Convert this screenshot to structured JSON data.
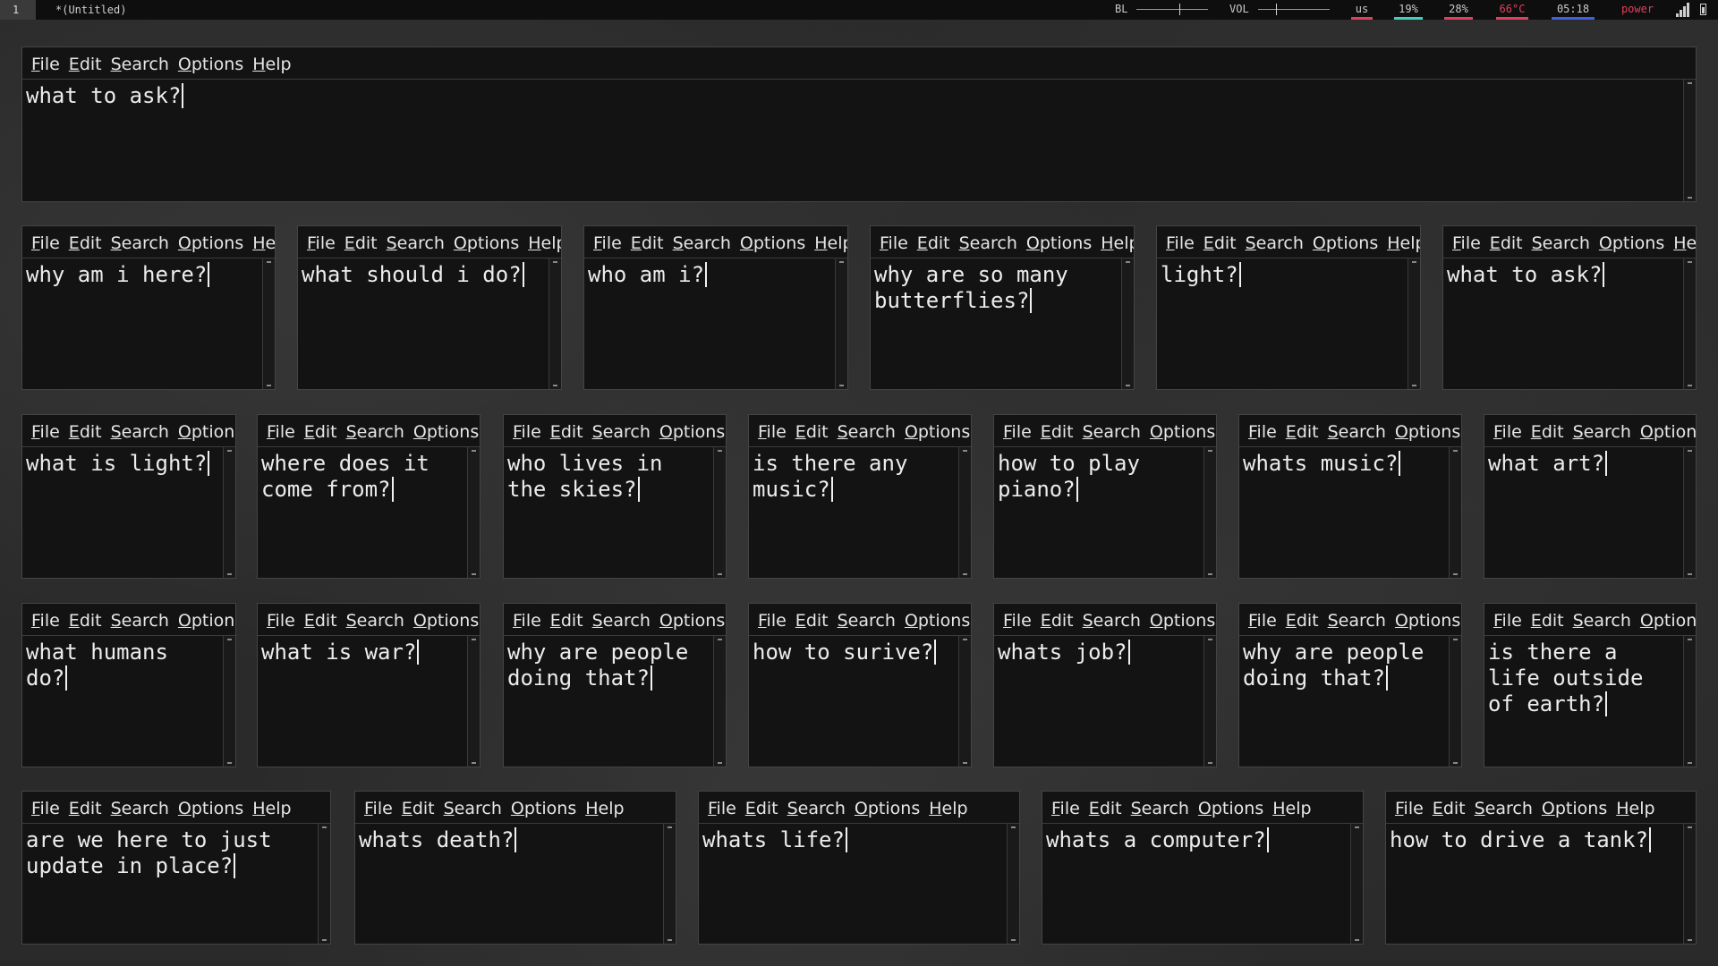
{
  "topbar": {
    "workspace": "1",
    "window_title": "*(Untitled)",
    "backlight_label": "BL",
    "backlight_level": 0.6,
    "volume_label": "VOL",
    "volume_level": 0.25,
    "keyboard_layout": "us",
    "cpu": "19%",
    "mem": "28%",
    "temp": "66°C",
    "time": "05:18",
    "power": "power",
    "colors": {
      "us": "#e0405a",
      "cpu": "#3fd0c0",
      "mem": "#e0405a",
      "temp": "#e0405a",
      "time": "#4060e0",
      "power": "#e0405a"
    },
    "icons": [
      "signal-bars-icon",
      "battery-icon"
    ]
  },
  "menu": [
    "File",
    "Edit",
    "Search",
    "Options",
    "Help"
  ],
  "windows": [
    {
      "text": "what to ask?"
    },
    {
      "text": "why am i here?"
    },
    {
      "text": "what should i do?"
    },
    {
      "text": "who am i?"
    },
    {
      "text": "why are so many\nbutterflies?"
    },
    {
      "text": "light?"
    },
    {
      "text": "what to ask?"
    },
    {
      "text": "what is light?"
    },
    {
      "text": "where does it\ncome from?"
    },
    {
      "text": "who lives in\nthe skies?"
    },
    {
      "text": "is there any\nmusic?"
    },
    {
      "text": "how to play\npiano?"
    },
    {
      "text": "whats music?"
    },
    {
      "text": "what art?"
    },
    {
      "text": "what humans do?"
    },
    {
      "text": "what is war?"
    },
    {
      "text": "why are people\ndoing that?"
    },
    {
      "text": "how to surive?"
    },
    {
      "text": "whats job?"
    },
    {
      "text": "why are people\ndoing that?"
    },
    {
      "text": "is there a\nlife outside\nof earth?"
    },
    {
      "text": "are we here to just\nupdate in place?"
    },
    {
      "text": "whats death?"
    },
    {
      "text": "whats life?"
    },
    {
      "text": "whats a computer?"
    },
    {
      "text": "how to drive a tank?"
    }
  ]
}
